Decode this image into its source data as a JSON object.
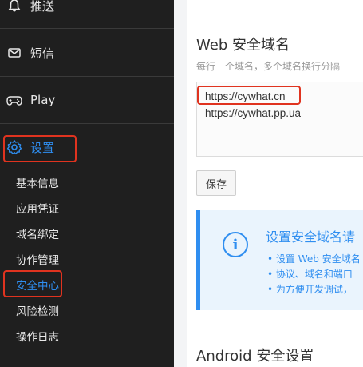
{
  "sidebar": {
    "nav": [
      {
        "label": "推送",
        "icon": "bell-icon"
      },
      {
        "label": "短信",
        "icon": "envelope-icon"
      },
      {
        "label": "Play",
        "icon": "gamepad-icon"
      },
      {
        "label": "设置",
        "icon": "gear-icon",
        "active": true
      }
    ],
    "sub_items": [
      {
        "label": "基本信息"
      },
      {
        "label": "应用凭证"
      },
      {
        "label": "域名绑定"
      },
      {
        "label": "协作管理"
      },
      {
        "label": "安全中心",
        "active": true
      },
      {
        "label": "风险检测"
      },
      {
        "label": "操作日志"
      }
    ]
  },
  "main": {
    "web_section": {
      "title": "Web 安全域名",
      "hint": "每行一个域名，多个域名换行分隔",
      "domains": [
        "https://cywhat.cn",
        "https://cywhat.pp.ua"
      ],
      "save_label": "保存"
    },
    "info": {
      "icon": "info-icon",
      "icon_glyph": "i",
      "title": "设置安全域名请",
      "bullets": [
        "设置 Web 安全域名",
        "协议、域名和端口",
        "为方便开发调试，"
      ]
    },
    "android_section": {
      "title": "Android 安全设置"
    }
  },
  "colors": {
    "sidebar_bg": "#1f1f1f",
    "accent": "#2f8ef0",
    "highlight_box": "#e0331f",
    "info_bg": "#eaf4fd"
  }
}
